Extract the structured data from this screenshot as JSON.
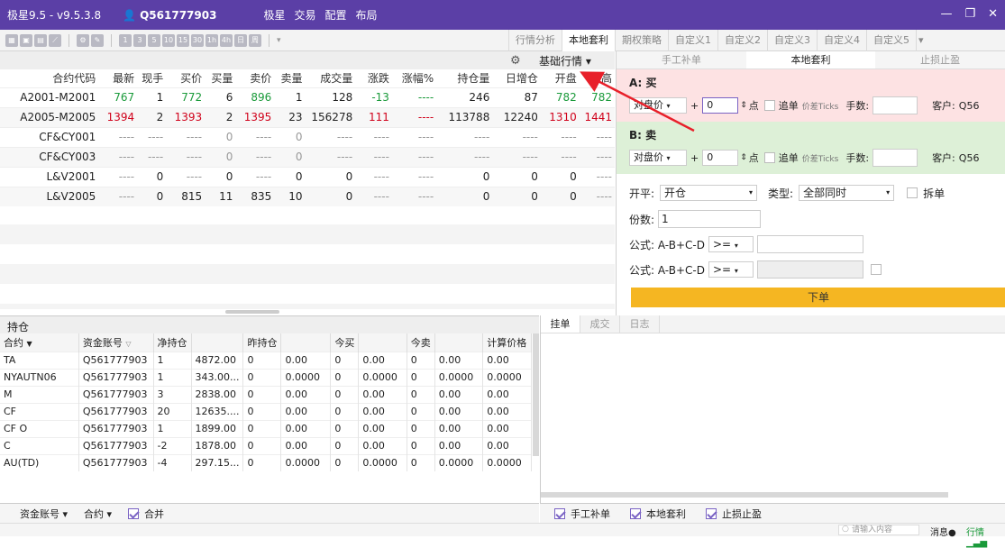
{
  "window": {
    "title": "极星9.5 - v9.5.3.8",
    "account": "Q561777903",
    "menu": [
      "极星",
      "交易",
      "配置",
      "布局"
    ]
  },
  "tabs": [
    "行情分析",
    "本地套利",
    "期权策略",
    "自定义1",
    "自定义2",
    "自定义3",
    "自定义4",
    "自定义5"
  ],
  "main_header": {
    "base_quote": "基础行情"
  },
  "quote_table": {
    "columns": [
      "合约代码",
      "最新",
      "现手",
      "买价",
      "买量",
      "卖价",
      "卖量",
      "成交量",
      "涨跌",
      "涨幅%",
      "持仓量",
      "日增仓",
      "开盘",
      "最高"
    ],
    "rows": [
      [
        "A2001-M2001",
        "767",
        "1",
        "772",
        "6",
        "896",
        "1",
        "128",
        "-13",
        "----",
        "246",
        "87",
        "782",
        "782"
      ],
      [
        "A2005-M2005",
        "1394",
        "2",
        "1393",
        "2",
        "1395",
        "23",
        "156278",
        "111",
        "----",
        "113788",
        "12240",
        "1310",
        "1441"
      ],
      [
        "CF&CY001",
        "----",
        "----",
        "----",
        "0",
        "----",
        "0",
        "----",
        "----",
        "----",
        "----",
        "----",
        "----",
        "----"
      ],
      [
        "CF&CY003",
        "----",
        "----",
        "----",
        "0",
        "----",
        "0",
        "----",
        "----",
        "----",
        "----",
        "----",
        "----",
        "----"
      ],
      [
        "L&V2001",
        "----",
        "0",
        "----",
        "0",
        "----",
        "0",
        "0",
        "----",
        "----",
        "0",
        "0",
        "0",
        "----"
      ],
      [
        "L&V2005",
        "----",
        "0",
        "815",
        "11",
        "835",
        "10",
        "0",
        "----",
        "----",
        "0",
        "0",
        "0",
        "----"
      ]
    ]
  },
  "right_panel": {
    "tabs": [
      "手工补单",
      "本地套利",
      "止损止盈"
    ],
    "leg_a": {
      "title": "A: 买",
      "price_type": "对盘价",
      "offset": "0",
      "unit": "点",
      "chase": "追单",
      "ticks": "价差Ticks",
      "qty_label": "手数:",
      "client_label": "客户:",
      "client": "Q56"
    },
    "leg_b": {
      "title": "B: 卖",
      "price_type": "对盘价",
      "offset": "0",
      "unit": "点",
      "chase": "追单",
      "ticks": "价差Ticks",
      "qty_label": "手数:",
      "client_label": "客户:",
      "client": "Q56"
    },
    "kaiping_label": "开平:",
    "kaiping_value": "开仓",
    "type_label": "类型:",
    "type_value": "全部同时",
    "split": "拆单",
    "shares_label": "份数:",
    "shares_value": "1",
    "formula1": "公式: A-B+C-D",
    "op1": ">=",
    "formula2": "公式: A-B+C-D",
    "op2": ">=",
    "order_button": "下单"
  },
  "positions": {
    "title": "持仓",
    "columns": [
      "合约",
      "资金账号",
      "净持仓",
      "",
      "昨持仓",
      "",
      "今买",
      "",
      "今卖",
      "",
      "计算价格"
    ],
    "rows": [
      [
        "TA",
        "Q561777903",
        "1",
        "4872.00",
        "0",
        "0.00",
        "0",
        "0.00",
        "0",
        "0.00",
        "0.00"
      ],
      [
        "NYAUTN06",
        "Q561777903",
        "1",
        "343.00...",
        "0",
        "0.0000",
        "0",
        "0.0000",
        "0",
        "0.0000",
        "0.0000"
      ],
      [
        "M",
        "Q561777903",
        "3",
        "2838.00",
        "0",
        "0.00",
        "0",
        "0.00",
        "0",
        "0.00",
        "0.00"
      ],
      [
        "CF",
        "Q561777903",
        "20",
        "12635....",
        "0",
        "0.00",
        "0",
        "0.00",
        "0",
        "0.00",
        "0.00"
      ],
      [
        "CF O",
        "Q561777903",
        "1",
        "1899.00",
        "0",
        "0.00",
        "0",
        "0.00",
        "0",
        "0.00",
        "0.00"
      ],
      [
        "C",
        "Q561777903",
        "-2",
        "1878.00",
        "0",
        "0.00",
        "0",
        "0.00",
        "0",
        "0.00",
        "0.00"
      ],
      [
        "AU(TD)",
        "Q561777903",
        "-4",
        "297.15...",
        "0",
        "0.0000",
        "0",
        "0.0000",
        "0",
        "0.0000",
        "0.0000"
      ]
    ]
  },
  "order_tabs": [
    "挂单",
    "成交",
    "日志"
  ],
  "bottom_left": {
    "account": "资金账号",
    "contract": "合约",
    "merge": "合并"
  },
  "bottom_right": {
    "manual": "手工补单",
    "local": "本地套利",
    "stop": "止损止盈"
  },
  "status": {
    "search_placeholder": "请输入内容",
    "msg": "消息",
    "quote": "行情"
  },
  "colors": {
    "title_bar": "#5b3fa6",
    "order_button": "#f5b622",
    "leg_a": "#fde2e3",
    "leg_b": "#ddf0d7",
    "up": "#d0021b",
    "down": "#1a9a3a"
  }
}
